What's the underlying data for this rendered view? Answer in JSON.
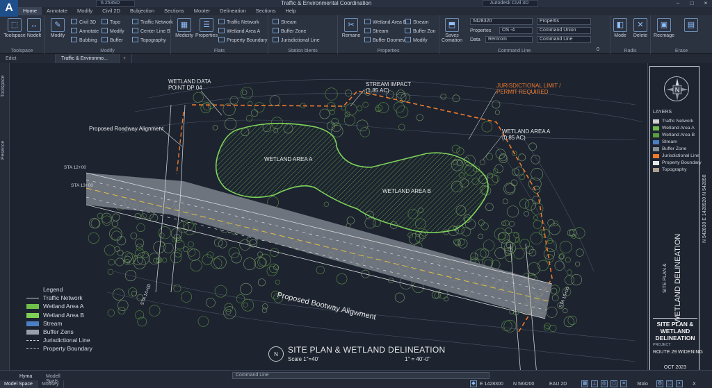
{
  "app": {
    "logo": "A",
    "window_title": "Traffic & Environmental Coordination",
    "quick_access": "6.253SD",
    "search_title": "Autodesk Civil 3D"
  },
  "menu": [
    "Home",
    "Annotate",
    "Modify",
    "Civil 2D",
    "Bubjection",
    "Sections",
    "Mooter",
    "Delineation",
    "Sections",
    "Help"
  ],
  "ribbon": {
    "toolspace": {
      "title": "Toolspace",
      "btn1": "Toolspace",
      "btn2": "Nodelt"
    },
    "modify_panel": {
      "title": "Modify",
      "big": "Modify",
      "items": [
        "Civil 3D",
        "Annotate",
        "Bubbing",
        "Topo",
        "Modify",
        "Buffer",
        "Traffic Network",
        "Center Line B",
        "Topography"
      ]
    },
    "flats": {
      "title": "Flats",
      "btn1": "Medicity",
      "btn2": "Properties",
      "items": [
        "Traffic Network",
        "Wetland Area A",
        "Property Boundary"
      ]
    },
    "stations": {
      "title": "Station blents",
      "items": [
        "Stream",
        "Buffer Zone",
        "Jurisdictional Line"
      ]
    },
    "properties": {
      "title": "Properties",
      "big": "Remane",
      "items": [
        "Wetland Area B",
        "Stream",
        "Buffer Doomev",
        "Stream",
        "Buffer Zon",
        "Modify"
      ]
    },
    "cmd": {
      "title": "Command Line",
      "big": "Saves Comation",
      "field1": "5428320",
      "lbl2": "Propertes",
      "field2": "OS -4",
      "lbl3": "Data",
      "field3": "Remrom",
      "dd1": "Propertis",
      "dd2": "Command Union",
      "dd3": "Command Line",
      "val": "0"
    },
    "radis": {
      "title": "Radis",
      "btn1": "Mode",
      "btn2": "Delete"
    },
    "erase": {
      "title": "Erase",
      "btn1": "Recmage"
    }
  },
  "doc_tabs": [
    "Edict",
    "Traffic & Environmo..."
  ],
  "left_tabs": [
    "Toolspace",
    "Pesence"
  ],
  "canvas": {
    "labels": {
      "wetland_data": "WETLAND DATA\nPOINT DP 04",
      "stream_impact": "STREAM IMPACT\n(1.85 AC)",
      "jurisdictional": "JURISDICTIONAL LIMIT /\nPERMIT REQUIRED",
      "proposed_roadway": "Proposed Roadway Alignment",
      "wetland_a_ac": "WETLAND AREA A\n(0.85 AC)",
      "wetland_a": "WETLAND AREA A",
      "wetland_b": "WETLAND AREA B",
      "road_along": "Proposed Bootway Aligwment",
      "sta_1": "STA 12+00",
      "sta_2": "STA 13+00",
      "sta_3": "STA 14+00",
      "sta_4": "STA 15+00"
    },
    "legend": [
      {
        "label": "Legend",
        "swatch": "none"
      },
      {
        "label": "Traffic Network",
        "swatch": "line"
      },
      {
        "label": "Wetland Area A",
        "swatch": "#6fbf4a"
      },
      {
        "label": "Wetland Area B",
        "swatch": "#7fcf56"
      },
      {
        "label": "Stream",
        "swatch": "#4a7fc4"
      },
      {
        "label": "Buffer Zens",
        "swatch": "#9aa0aa"
      },
      {
        "label": "Jurisdictional Line",
        "swatch": "dash"
      },
      {
        "label": "Property Boundary",
        "swatch": "dashdot"
      }
    ],
    "title_block": {
      "north": "N",
      "title": "SITE PLAN & WETLAND DELINEATION",
      "scale_left": "Scale 1\"=40'",
      "scale_right": "1\" = 40'-0\""
    }
  },
  "right_panel": {
    "compass": "N",
    "layers_head": "LAYERS",
    "layers": [
      {
        "name": "Traffic Network",
        "color": "#d0d0d0"
      },
      {
        "name": "Wetland Area A",
        "color": "#6fbf4a"
      },
      {
        "name": "Wetland Area B",
        "color": "#5aa040"
      },
      {
        "name": "Stream",
        "color": "#4a7fc4"
      },
      {
        "name": "Buffer Zone",
        "color": "#8a9098"
      },
      {
        "name": "Jurisdictional Line",
        "color": "#f07a2c"
      },
      {
        "name": "Property Boundary",
        "color": "#e6e6e6"
      },
      {
        "name": "Topography",
        "color": "#b0a090"
      }
    ],
    "vert_title": "WETLAND DELINEATION",
    "vert_sub": "SITE PLAN &",
    "title": "SITE PLAN & WETLAND DELINEATION",
    "project_label": "PROJECT",
    "project": "ROUTE 29 WIDENING",
    "date": "OCT 2023",
    "side_text": "N 542830 E 1428920 N 542850"
  },
  "status": {
    "cmdline": "Command Line",
    "model_tabs": [
      "Hyma",
      "Modell Spats"
    ],
    "workspace": [
      "Model Space",
      "Modsey"
    ],
    "coord_e": "E 1428300",
    "coord_n": "N 583200",
    "mode": "EAU 2D",
    "snap": "Stolo",
    "x": "X"
  },
  "colors": {
    "wetland": "#6fbf4a",
    "jurisdiction": "#f07a2c",
    "road": "#9aa0a6",
    "canvas": "#1d2430"
  }
}
